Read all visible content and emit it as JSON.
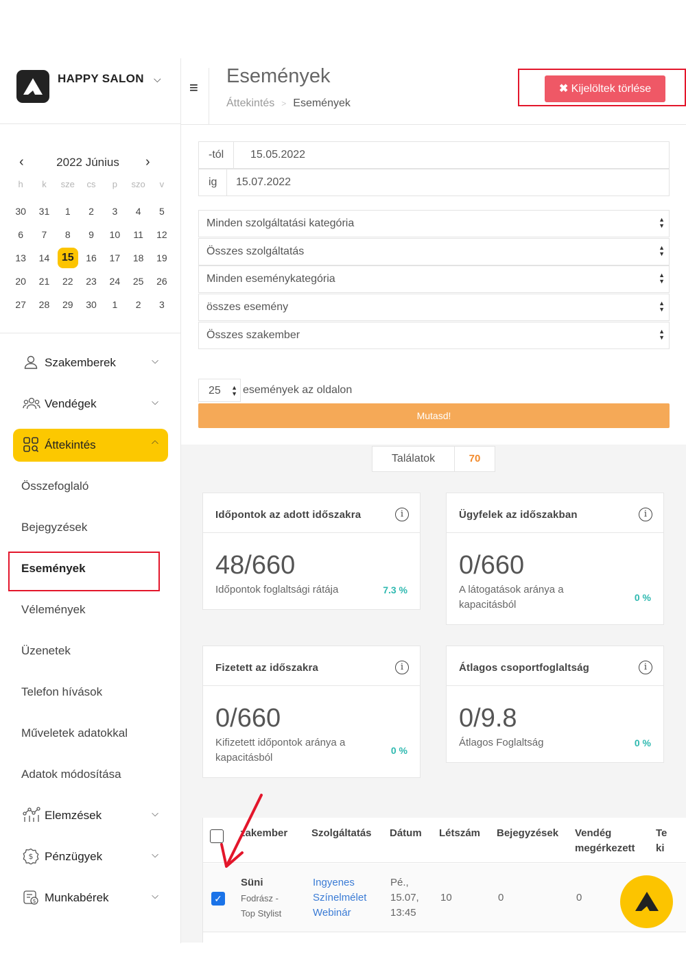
{
  "brand": {
    "name": "HAPPY SALON"
  },
  "calendar": {
    "title": "2022 Június",
    "weekdays": [
      "h",
      "k",
      "sze",
      "cs",
      "p",
      "szo",
      "v"
    ],
    "weeks": [
      [
        "30",
        "31",
        "1",
        "2",
        "3",
        "4",
        "5"
      ],
      [
        "6",
        "7",
        "8",
        "9",
        "10",
        "11",
        "12"
      ],
      [
        "13",
        "14",
        "15",
        "16",
        "17",
        "18",
        "19"
      ],
      [
        "20",
        "21",
        "22",
        "23",
        "24",
        "25",
        "26"
      ],
      [
        "27",
        "28",
        "29",
        "30",
        "1",
        "2",
        "3"
      ]
    ],
    "today": "15"
  },
  "nav": {
    "szakemberek": "Szakemberek",
    "vendegek": "Vendégek",
    "attekintes": "Áttekintés",
    "sub": [
      "Összefoglaló",
      "Bejegyzések",
      "Események",
      "Vélemények",
      "Üzenetek",
      "Telefon hívások",
      "Műveletek adatokkal",
      "Adatok módosítása"
    ],
    "current": "Események",
    "elemzesek": "Elemzések",
    "penzugyek": "Pénzügyek",
    "munkaberek": "Munkabérek"
  },
  "header": {
    "title": "Események",
    "breadcrumb": [
      "Áttekintés",
      "Események"
    ],
    "delete_button": "Kijelöltek törlése"
  },
  "filters": {
    "from_label": "-tól",
    "from_value": "15.05.2022",
    "to_label": "ig",
    "to_value": "15.07.2022",
    "selects": [
      "Minden szolgáltatási kategória",
      "Összes szolgáltatás",
      "Minden eseménykategória",
      "összes esemény",
      "Összes szakember"
    ],
    "per_page": "25",
    "per_page_label": "események az oldalon",
    "show_button": "Mutasd!"
  },
  "results": {
    "label": "Találatok",
    "count": "70"
  },
  "cards": [
    {
      "title": "Időpontok az adott időszakra",
      "value": "48/660",
      "desc": "Időpontok foglaltsági rátája",
      "pct": "7.3 %"
    },
    {
      "title": "Ügyfelek az időszakban",
      "value": "0/660",
      "desc": "A látogatások aránya a kapacitásból",
      "pct": "0 %"
    },
    {
      "title": "Fizetett az időszakra",
      "value": "0/660",
      "desc": "Kifizetett időpontok aránya a kapacitásból",
      "pct": "0 %"
    },
    {
      "title": "Átlagos csoportfoglaltság",
      "value": "0/9.8",
      "desc": "Átlagos Foglaltság",
      "pct": "0 %"
    }
  ],
  "table": {
    "headers": [
      "zakember",
      "Szolgáltatás",
      "Dátum",
      "Létszám",
      "Bejegyzések",
      "Vendég",
      "megérkezett",
      "Te",
      "ki"
    ],
    "row": {
      "name": "Süni",
      "role_1": "Fodrász -",
      "role_2": "Top Stylist",
      "service_1": "Ingyenes",
      "service_2": "Színelmélet",
      "service_3": "Webinár",
      "date_1": "Pé.,",
      "date_2": "15.07,",
      "date_3": "13:45",
      "count": "10",
      "entries": "0",
      "arrived": "0"
    }
  },
  "colors": {
    "accent": "#fcc800",
    "danger": "#ef5866",
    "button_orange": "#f5a957",
    "teal": "#2fb9b0",
    "annotation_red": "#e3162b"
  }
}
